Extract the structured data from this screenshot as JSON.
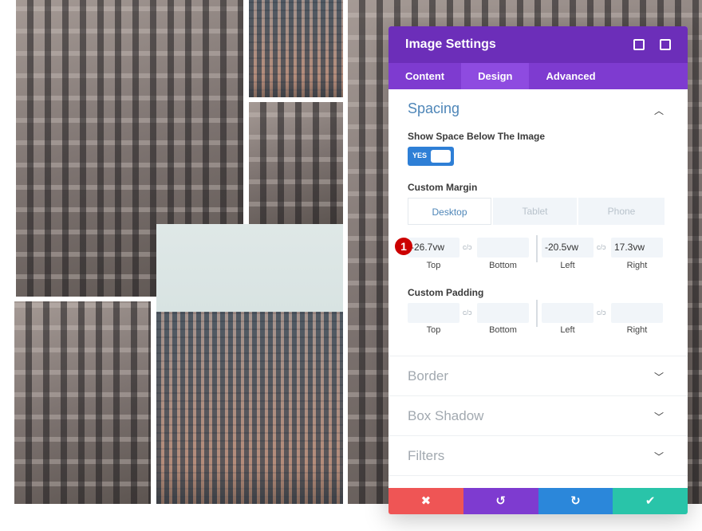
{
  "panel": {
    "title": "Image Settings",
    "header_icons": [
      "fullscreen-icon",
      "sidebar-icon"
    ],
    "tabs": [
      {
        "label": "Content"
      },
      {
        "label": "Design",
        "active": true
      },
      {
        "label": "Advanced"
      }
    ],
    "spacing": {
      "title": "Spacing",
      "show_space_label": "Show Space Below The Image",
      "toggle_value": "YES",
      "margin_label": "Custom Margin",
      "devices": [
        "Desktop",
        "Tablet",
        "Phone"
      ],
      "margin": {
        "top": "-26.7vw",
        "bottom": "",
        "left": "-20.5vw",
        "right": "17.3vw"
      },
      "padding_label": "Custom Padding",
      "padding": {
        "top": "",
        "bottom": "",
        "left": "",
        "right": ""
      },
      "sides": [
        "Top",
        "Bottom",
        "Left",
        "Right"
      ],
      "link_glyph": "c/ↄ",
      "badge": "1"
    },
    "sections": [
      "Border",
      "Box Shadow",
      "Filters"
    ],
    "footer": {
      "cancel": "✖",
      "undo": "↺",
      "redo": "↻",
      "save": "✔"
    },
    "colors": {
      "header": "#6c2eb9",
      "tabs": "#7e3bd0",
      "cancel": "#ef5555",
      "undo": "#7e3bd0",
      "redo": "#2b87da",
      "save": "#29c4a9"
    }
  }
}
